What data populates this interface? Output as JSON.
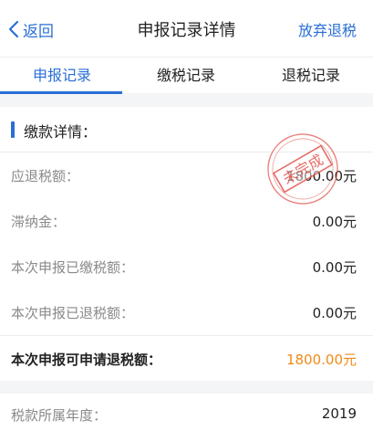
{
  "navbar": {
    "back_label": "返回",
    "title": "申报记录详情",
    "action_label": "放弃退税"
  },
  "tabs": [
    {
      "label": "申报记录",
      "active": true
    },
    {
      "label": "缴税记录",
      "active": false
    },
    {
      "label": "退税记录",
      "active": false
    }
  ],
  "payment_section": {
    "title": "缴款详情：",
    "rows": [
      {
        "label": "应退税额：",
        "value": "1800.00元"
      },
      {
        "label": "滞纳金：",
        "value": "0.00元"
      },
      {
        "label": "本次申报已缴税额：",
        "value": "0.00元"
      },
      {
        "label": "本次申报已退税额：",
        "value": "0.00元"
      }
    ],
    "total": {
      "label": "本次申报可申请退税额：",
      "value": "1800.00元"
    }
  },
  "stamp": {
    "text": "未完成"
  },
  "year_row": {
    "label": "税款所属年度：",
    "value": "2019"
  },
  "colors": {
    "accent": "#2a6fd6",
    "highlight": "#f08a17",
    "stamp": "#e0574f"
  }
}
